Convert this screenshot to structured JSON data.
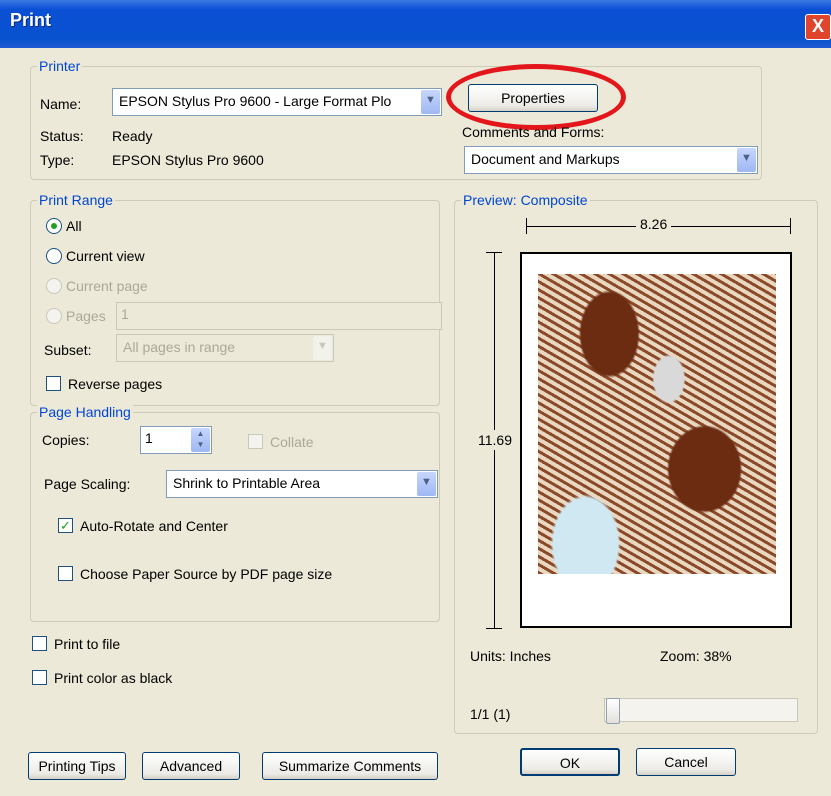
{
  "window": {
    "title": "Print",
    "close": "X"
  },
  "printer": {
    "group_label": "Printer",
    "name_label": "Name:",
    "name_value": "EPSON Stylus Pro 9600 - Large Format Plo",
    "properties_label": "Properties",
    "status_label": "Status:",
    "status_value": "Ready",
    "type_label": "Type:",
    "type_value": "EPSON Stylus Pro 9600",
    "comments_label": "Comments and Forms:",
    "comments_value": "Document and Markups"
  },
  "print_range": {
    "group_label": "Print Range",
    "all": "All",
    "current_view": "Current view",
    "current_page": "Current page",
    "pages": "Pages",
    "pages_value": "1",
    "subset_label": "Subset:",
    "subset_value": "All pages in range",
    "reverse_pages": "Reverse pages"
  },
  "page_handling": {
    "group_label": "Page Handling",
    "copies_label": "Copies:",
    "copies_value": "1",
    "collate": "Collate",
    "scaling_label": "Page Scaling:",
    "scaling_value": "Shrink to Printable Area",
    "auto_rotate": "Auto-Rotate and Center",
    "auto_rotate_checked": true,
    "choose_paper": "Choose Paper Source by PDF page size"
  },
  "options": {
    "print_to_file": "Print to file",
    "print_color_black": "Print color as black"
  },
  "preview": {
    "group_label": "Preview: Composite",
    "width_value": "8.26",
    "height_value": "11.69",
    "units": "Units: Inches",
    "zoom": "Zoom:  38%",
    "page_indicator": "1/1 (1)"
  },
  "buttons": {
    "printing_tips": "Printing Tips",
    "advanced": "Advanced",
    "summarize": "Summarize Comments",
    "ok": "OK",
    "cancel": "Cancel"
  },
  "colors": {
    "accent": "#0046d5",
    "highlight": "#e3171b",
    "titlebar": "#0852d0"
  }
}
